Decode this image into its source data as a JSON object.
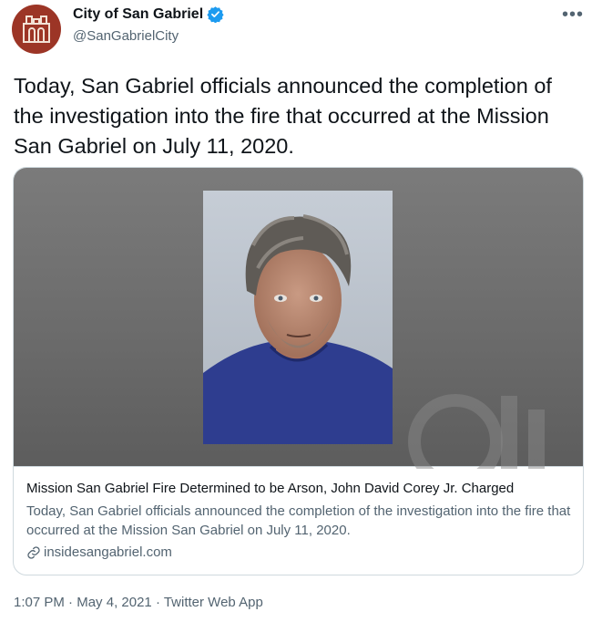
{
  "account": {
    "name": "City of San Gabriel",
    "handle": "@SanGabrielCity",
    "verified_icon": "verified-badge-icon",
    "avatar_color": "#9c3526"
  },
  "menu_icon": "more-dots-icon",
  "menu_glyph": "•••",
  "tweet": {
    "text": "Today, San Gabriel officials announced the completion of the investigation into the fire that occurred at the Mission San Gabriel on July 11, 2020."
  },
  "card": {
    "title": "Mission San Gabriel Fire Determined to be Arson, John David Corey Jr. Charged",
    "description": "Today, San Gabriel officials announced the completion of the investigation into the fire that occurred at the Mission San Gabriel on July 11, 2020.",
    "domain": "insidesangabriel.com",
    "link_icon": "link-icon"
  },
  "meta": {
    "time": "1:07 PM",
    "separator": " · ",
    "date": "May 4, 2021",
    "source": "Twitter Web App"
  },
  "colors": {
    "text_primary": "#0f1419",
    "text_secondary": "#536471",
    "verified_blue": "#1d9bf0",
    "border": "#cfd9de"
  }
}
